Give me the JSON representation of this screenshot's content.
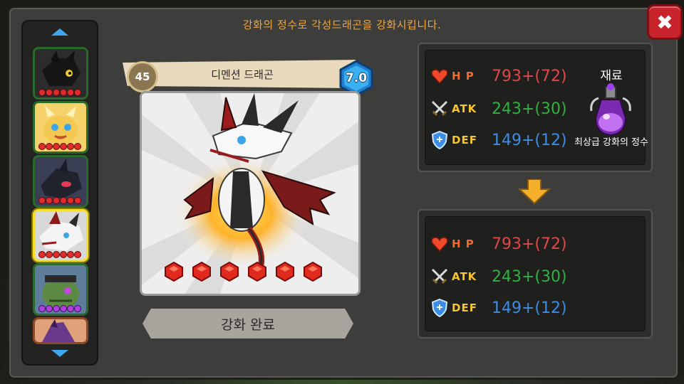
{
  "title": "강화의 정수로 각성드래곤을 강화시킵니다.",
  "close_label": "✖",
  "dragon": {
    "level": "45",
    "name": "디멘션 드래곤",
    "grade": "7.0",
    "gem_count": 6
  },
  "complete_button": "강화 완료",
  "current_stats": {
    "hp_label": "H P",
    "hp": "793+(72)",
    "atk_label": "ATK",
    "atk": "243+(30)",
    "def_label": "DEF",
    "def": "149+(12)"
  },
  "result_stats": {
    "hp_label": "H P",
    "hp": "793+(72)",
    "atk_label": "ATK",
    "atk": "243+(30)",
    "def_label": "DEF",
    "def": "149+(12)"
  },
  "material": {
    "title": "재료",
    "name": "최상급 강화의 정수"
  },
  "sidebar": {
    "items": [
      {
        "id": "dragon-black",
        "color": "#1d1d1d"
      },
      {
        "id": "dragon-gold",
        "color": "#f2c24a"
      },
      {
        "id": "dragon-dark-red-eye",
        "color": "#2a2a2a"
      },
      {
        "id": "dragon-dimension",
        "color": "#b8b8b8",
        "selected": true
      },
      {
        "id": "dragon-green-zombie",
        "color": "#4e7a3d"
      },
      {
        "id": "dragon-purple",
        "color": "#6a3a8a"
      }
    ]
  },
  "colors": {
    "hp": "#e14747",
    "atk": "#2fb240",
    "def": "#3b8de6",
    "accent": "#f0a53a"
  }
}
